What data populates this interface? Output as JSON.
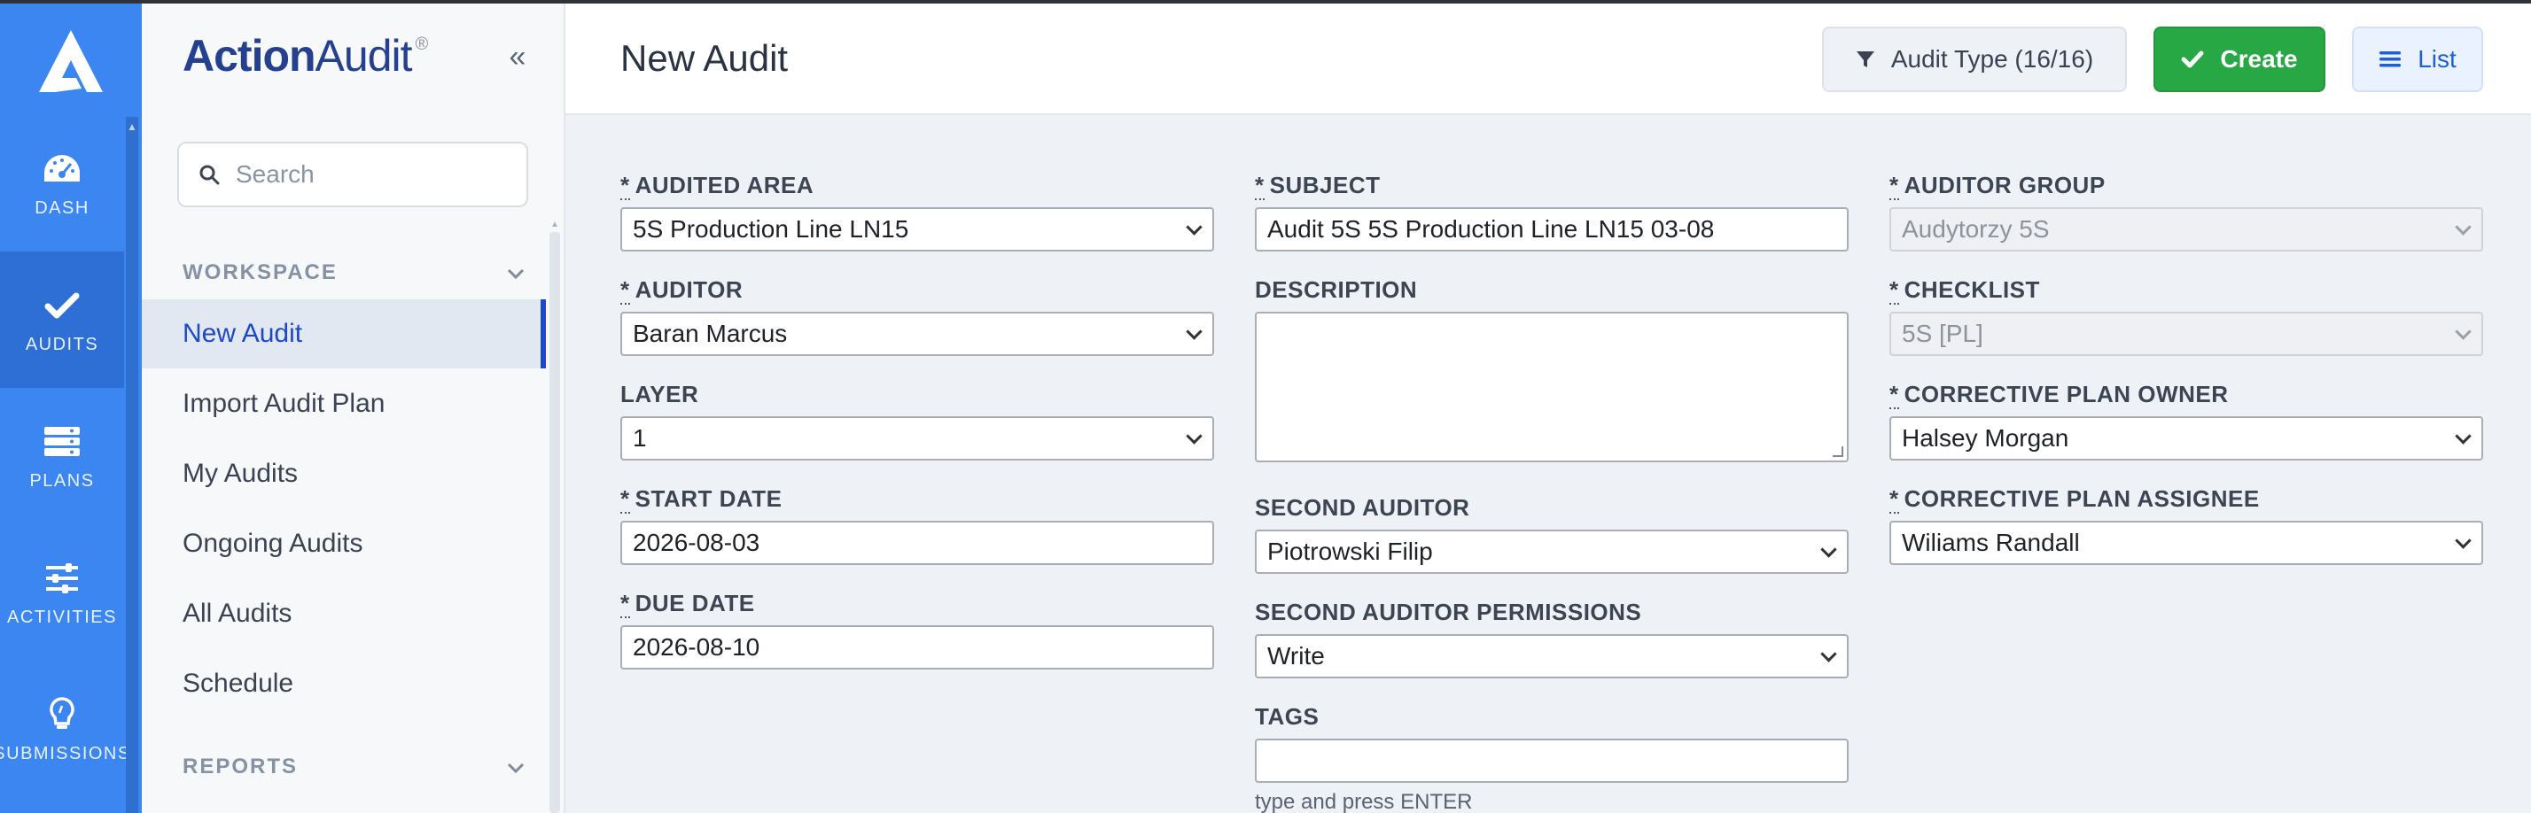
{
  "rail": {
    "items": [
      {
        "label": "DASH",
        "icon": "dashboard-gauge-icon"
      },
      {
        "label": "AUDITS",
        "icon": "checkmark-icon"
      },
      {
        "label": "PLANS",
        "icon": "plans-list-icon"
      },
      {
        "label": "ACTIVITIES",
        "icon": "sliders-icon"
      },
      {
        "label": "SUBMISSIONS",
        "icon": "lightbulb-icon"
      }
    ]
  },
  "sidebar": {
    "brand_bold": "Action",
    "brand_light": "Audit",
    "brand_mark": "®",
    "collapse_icon": "«",
    "search_placeholder": "Search",
    "workspace_label": "WORKSPACE",
    "reports_label": "REPORTS",
    "items": [
      {
        "label": "New Audit"
      },
      {
        "label": "Import Audit Plan"
      },
      {
        "label": "My Audits"
      },
      {
        "label": "Ongoing Audits"
      },
      {
        "label": "All Audits"
      },
      {
        "label": "Schedule"
      }
    ]
  },
  "header": {
    "title": "New Audit",
    "filter_label": "Audit Type (16/16)",
    "create_label": "Create",
    "list_label": "List"
  },
  "form": {
    "audited_area": {
      "label": "AUDITED AREA",
      "value": "5S Production Line LN15"
    },
    "auditor": {
      "label": "AUDITOR",
      "value": "Baran Marcus"
    },
    "layer": {
      "label": "LAYER",
      "value": "1"
    },
    "start_date": {
      "label": "START DATE",
      "value": "2026-08-03"
    },
    "due_date": {
      "label": "DUE DATE",
      "value": "2026-08-10"
    },
    "subject": {
      "label": "SUBJECT",
      "value": "Audit 5S 5S Production Line LN15 03-08"
    },
    "description": {
      "label": "DESCRIPTION",
      "value": ""
    },
    "second_auditor": {
      "label": "SECOND AUDITOR",
      "value": "Piotrowski Filip"
    },
    "second_auditor_permissions": {
      "label": "SECOND AUDITOR PERMISSIONS",
      "value": "Write"
    },
    "tags": {
      "label": "TAGS",
      "value": "",
      "hint": "type and press ENTER"
    },
    "auditor_group": {
      "label": "AUDITOR GROUP",
      "value": "Audytorzy 5S"
    },
    "checklist": {
      "label": "CHECKLIST",
      "value": "5S [PL]"
    },
    "corrective_plan_owner": {
      "label": "CORRECTIVE PLAN OWNER",
      "value": "Halsey Morgan"
    },
    "corrective_plan_assignee": {
      "label": "CORRECTIVE PLAN ASSIGNEE",
      "value": "Wiliams Randall"
    },
    "required_mark": "*"
  },
  "colors": {
    "rail_bg": "#3b86f0",
    "brand": "#24408e",
    "accent": "#1c49c7",
    "create_green": "#28a745"
  }
}
